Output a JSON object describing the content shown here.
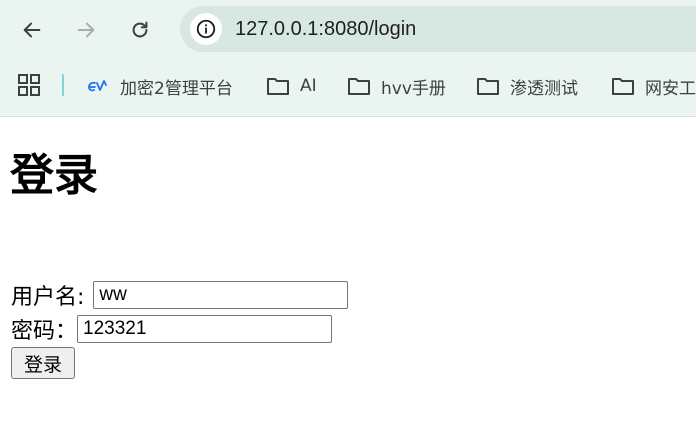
{
  "browser": {
    "url": "127.0.0.1:8080/login",
    "bookmarks": [
      {
        "label": "加密2管理平台",
        "icon": "ev-logo-icon"
      },
      {
        "label": "AI",
        "icon": "folder-icon"
      },
      {
        "label": "hvv手册",
        "icon": "folder-icon"
      },
      {
        "label": "渗透测试",
        "icon": "folder-icon"
      },
      {
        "label": "网安工",
        "icon": "folder-icon"
      }
    ]
  },
  "page": {
    "title": "登录",
    "username_label": "用户名:",
    "username_value": "ww",
    "password_label": "密码：",
    "password_value": "123321",
    "submit_label": "登录"
  },
  "colors": {
    "chrome_bg": "#eaf4f0",
    "omnibox_bg": "#d7e8e2",
    "accent": "#1a73e8"
  }
}
